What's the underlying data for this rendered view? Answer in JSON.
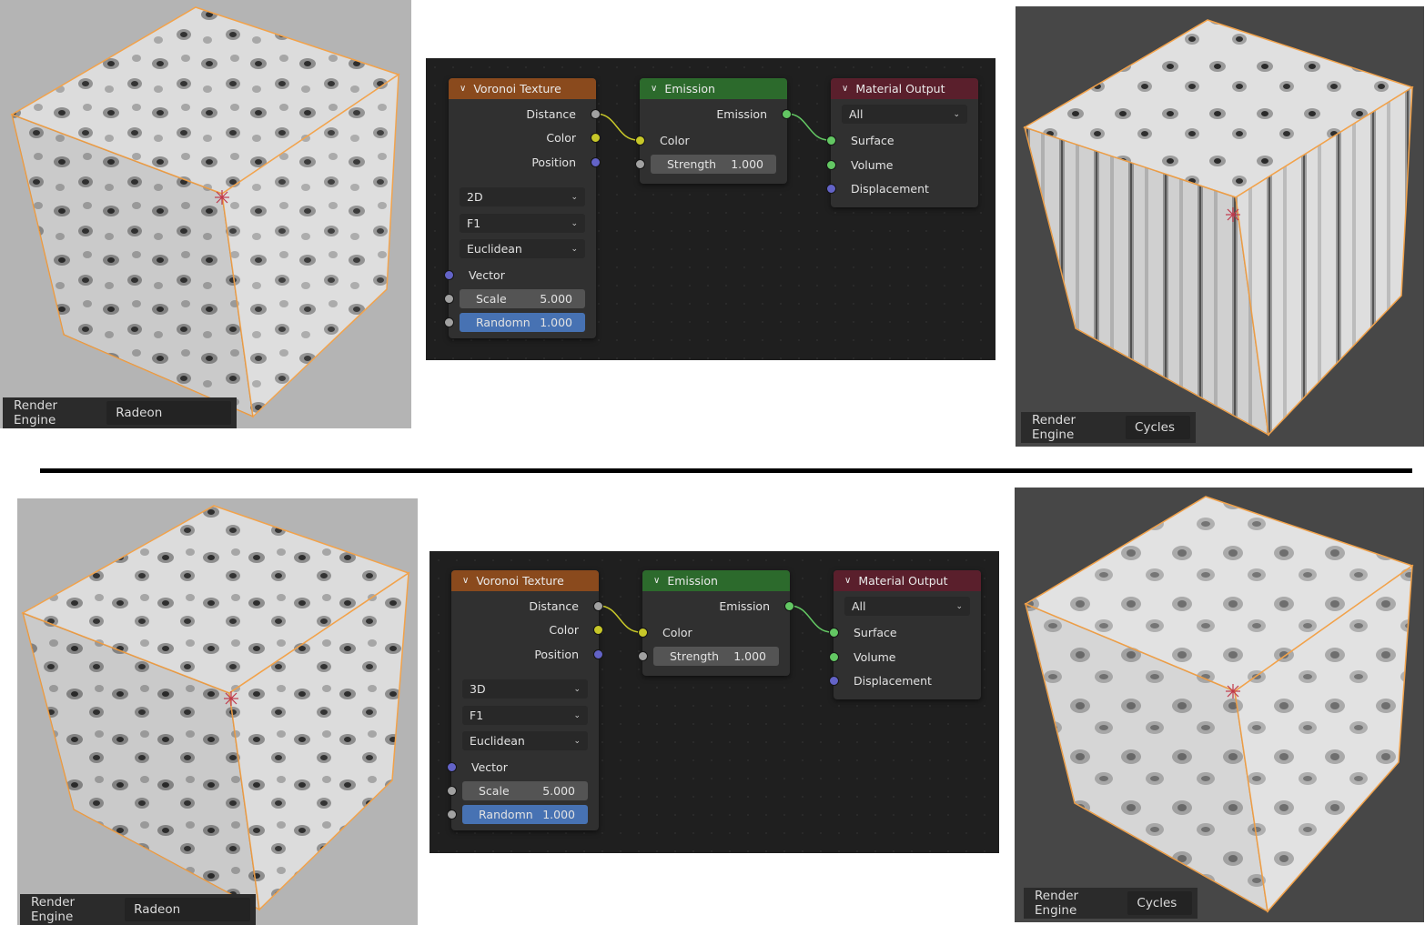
{
  "panels": [
    {
      "viewport_left": {
        "engine_label": "Render Engine",
        "engine_value": "Radeon ProRender"
      },
      "node_editor": {
        "voronoi": {
          "title": "Voronoi Texture",
          "outputs": [
            "Distance",
            "Color",
            "Position"
          ],
          "dimension": "2D",
          "feature": "F1",
          "metric": "Euclidean",
          "vector_label": "Vector",
          "scale_label": "Scale",
          "scale_value": "5.000",
          "random_label": "Randomn",
          "random_value": "1.000"
        },
        "emission": {
          "title": "Emission",
          "output": "Emission",
          "color_label": "Color",
          "strength_label": "Strength",
          "strength_value": "1.000"
        },
        "material_output": {
          "title": "Material Output",
          "target": "All",
          "inputs": [
            "Surface",
            "Volume",
            "Displacement"
          ]
        }
      },
      "viewport_right": {
        "engine_label": "Render Engine",
        "engine_value": "Cycles"
      }
    },
    {
      "viewport_left": {
        "engine_label": "Render Engine",
        "engine_value": "Radeon ProRender"
      },
      "node_editor": {
        "voronoi": {
          "title": "Voronoi Texture",
          "outputs": [
            "Distance",
            "Color",
            "Position"
          ],
          "dimension": "3D",
          "feature": "F1",
          "metric": "Euclidean",
          "vector_label": "Vector",
          "scale_label": "Scale",
          "scale_value": "5.000",
          "random_label": "Randomn",
          "random_value": "1.000"
        },
        "emission": {
          "title": "Emission",
          "output": "Emission",
          "color_label": "Color",
          "strength_label": "Strength",
          "strength_value": "1.000"
        },
        "material_output": {
          "title": "Material Output",
          "target": "All",
          "inputs": [
            "Surface",
            "Volume",
            "Displacement"
          ]
        }
      },
      "viewport_right": {
        "engine_label": "Render Engine",
        "engine_value": "Cycles"
      }
    }
  ],
  "colors": {
    "viewport_light_bg": "#b4b4b4",
    "viewport_dark_bg": "#474747",
    "selection_outline": "#f2a24a",
    "editor_bg": "#1f1f1f",
    "node_body": "#303030",
    "texture_header": "#8a4a1d",
    "shader_header": "#2c6a2c",
    "output_header": "#5a1f2c",
    "socket_float": "#a1a1a1",
    "socket_color": "#c7c729",
    "socket_vector": "#6363c7",
    "socket_shader": "#63c763",
    "random_field": "#4772b3"
  },
  "icons": [
    "chevron-down-icon",
    "dropdown-arrow-icon",
    "object-origin-icon"
  ]
}
